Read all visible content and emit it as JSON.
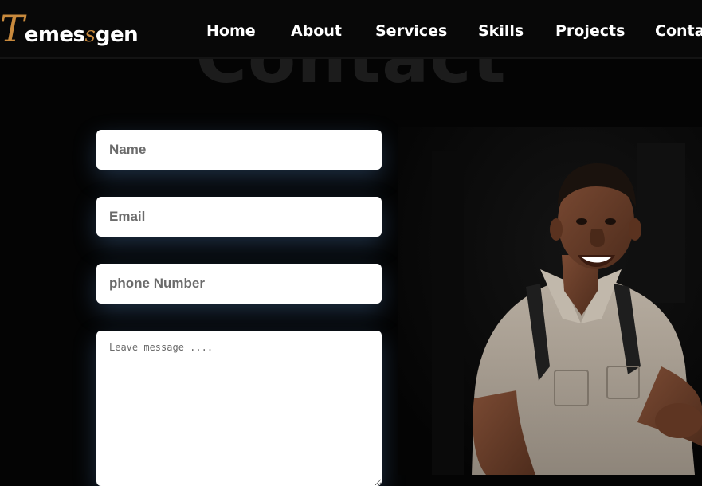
{
  "logo": {
    "first": "T",
    "part1": "emes",
    "accent": "s",
    "part2": "gen"
  },
  "nav": {
    "items": [
      "Home",
      "About",
      "Services",
      "Skills",
      "Projects",
      "Contact"
    ]
  },
  "section": {
    "title": "Contact"
  },
  "form": {
    "name_placeholder": "Name",
    "email_placeholder": "Email",
    "phone_placeholder": "phone Number",
    "message_placeholder": "Leave message ...."
  },
  "colors": {
    "background": "#040404",
    "accent": "#c98a3d",
    "field_glow": "#5082be"
  },
  "icons": {
    "resize_handle": "resize-grip-icon"
  }
}
